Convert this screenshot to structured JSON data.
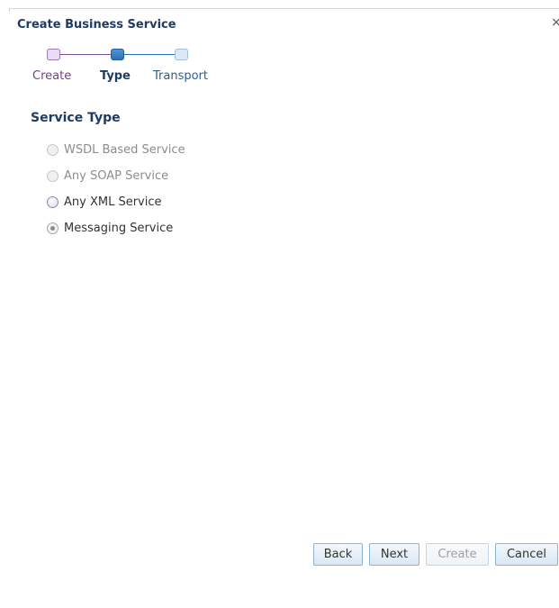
{
  "dialog": {
    "title": "Create Business Service",
    "close_glyph": "×"
  },
  "train": {
    "steps": [
      {
        "label": "Create",
        "state": "visited",
        "color": "#7a3d8f"
      },
      {
        "label": "Type",
        "state": "current",
        "color": "#2c6fb2"
      },
      {
        "label": "Transport",
        "state": "unvisited",
        "color": "#9fbfdf"
      }
    ]
  },
  "service_type": {
    "title": "Service Type",
    "options": [
      {
        "label": "WSDL Based Service",
        "enabled": false,
        "selected": false
      },
      {
        "label": "Any SOAP Service",
        "enabled": false,
        "selected": false
      },
      {
        "label": "Any XML Service",
        "enabled": true,
        "selected": false
      },
      {
        "label": "Messaging Service",
        "enabled": true,
        "selected": true
      }
    ]
  },
  "buttons": {
    "back": "Back",
    "next": "Next",
    "create": "Create",
    "cancel": "Cancel",
    "create_enabled": false
  },
  "colors": {
    "title": "#1f3b62",
    "button_border": "#8fb3d4",
    "disabled_text": "#8c8c8c"
  }
}
